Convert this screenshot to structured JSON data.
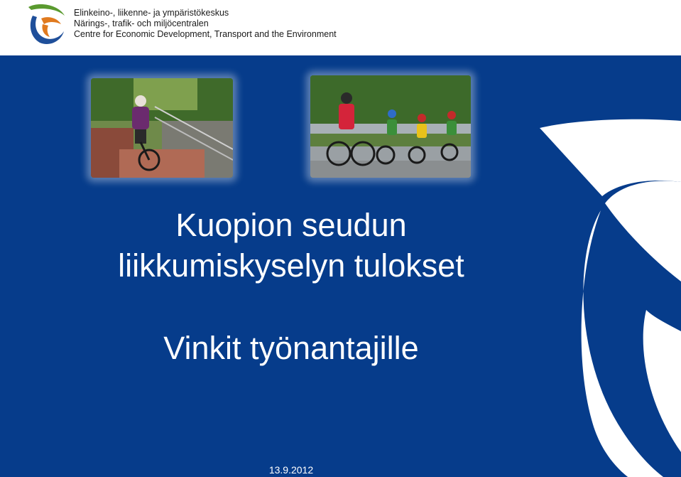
{
  "header": {
    "logo_icon": "ely-centre-logo",
    "org_lines": [
      "Elinkeino-, liikenne- ja ympäristökeskus",
      "Närings-, trafik- och miljöcentralen",
      "Centre for Economic Development, Transport and the Environment"
    ]
  },
  "slide": {
    "background_color": "#063c8b",
    "photos": [
      {
        "icon": "photo-elderly-woman-cycling"
      },
      {
        "icon": "photo-family-cycling"
      }
    ],
    "title_lines": [
      "Kuopion seudun",
      "liikkumiskyselyn tulokset"
    ],
    "subtitle": "Vinkit työnantajille",
    "date": "13.9.2012",
    "watermark_icon": "ely-watermark-shape"
  },
  "colors": {
    "brand_blue": "#063c8b",
    "logo_green": "#5a9a2f",
    "logo_orange": "#e07a1f",
    "logo_blue": "#1f4f9a"
  }
}
